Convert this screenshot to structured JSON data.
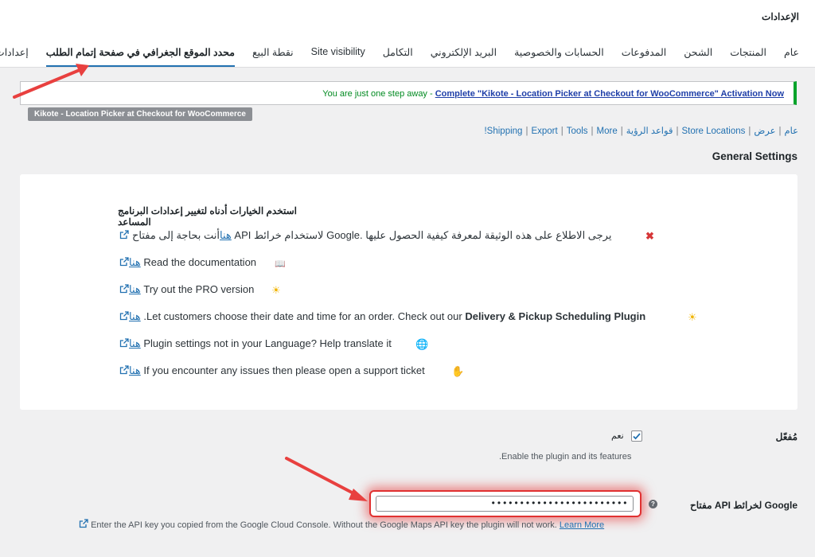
{
  "page_title": "الإعدادات",
  "tabs": [
    {
      "label": "عام"
    },
    {
      "label": "المنتجات"
    },
    {
      "label": "الشحن"
    },
    {
      "label": "المدفوعات"
    },
    {
      "label": "الحسابات والخصوصية"
    },
    {
      "label": "البريد الإلكتروني"
    },
    {
      "label": "التكامل"
    },
    {
      "label": "Site visibility"
    },
    {
      "label": "نقطة البيع"
    },
    {
      "label": "محدد الموقع الجغرافي في صفحة إتمام الطلب"
    },
    {
      "label": "إعدادات متقدمة"
    }
  ],
  "notice": {
    "lead": "You are just one step away - ",
    "link": "Complete \"Kikote - Location Picker at Checkout for WooCommerce\" Activation Now"
  },
  "plugin_tag": "Kikote - Location Picker at Checkout for WooCommerce",
  "sublinks": [
    "عام",
    "عرض",
    "Store Locations",
    "قواعد الرؤية",
    "Shipping",
    "Export",
    "Tools",
    "More!"
  ],
  "section_title": "General Settings",
  "card": {
    "heading": "استخدم الخيارات أدناه لتغيير إعدادات البرنامج المساعد",
    "rows": [
      {
        "icon": "✖",
        "text": "أنت بحاجة إلى مفتاح API لاستخدام خرائط Google. يرجى الاطلاع على هذه الوثيقة لمعرفة كيفية الحصول عليها",
        "link": "هنا"
      },
      {
        "icon": "📖",
        "text": "Read the documentation",
        "link": "هنا"
      },
      {
        "icon": "☀",
        "text": "Try out the PRO version",
        "link": "هنا"
      },
      {
        "icon": "☀",
        "text_pre": ".Let customers choose their date and time for an order. Check out our ",
        "text_bold": "Delivery & Pickup Scheduling Plugin",
        "link": "هنا"
      },
      {
        "icon": "🌐",
        "text": "Plugin settings not in your Language? Help translate it",
        "link": "هنا"
      },
      {
        "icon": "✋",
        "text": "If you encounter any issues then please open a support ticket",
        "link": "هنا"
      }
    ]
  },
  "enabled_field": {
    "label": "مُفعّل",
    "checkbox_label": "نعم",
    "checked": true,
    "help": ".Enable the plugin and its features"
  },
  "api_field": {
    "label": "مفتاح API لخرائط Google",
    "value": "••••••••••••••••••••••••",
    "help": "Enter the API key you copied from the Google Cloud Console. Without the Google Maps API key the plugin will not work.",
    "help_link": "Learn More",
    "help_icon": "?"
  },
  "colors": {
    "accent": "#2271b1",
    "notice_border": "#00a32a",
    "highlight": "#e03131",
    "arrow": "#e8403f"
  },
  "icons": [
    "external-link-icon",
    "close-icon",
    "book-icon",
    "sun-icon",
    "globe-icon",
    "hand-icon",
    "help-icon",
    "checkmark-icon"
  ]
}
